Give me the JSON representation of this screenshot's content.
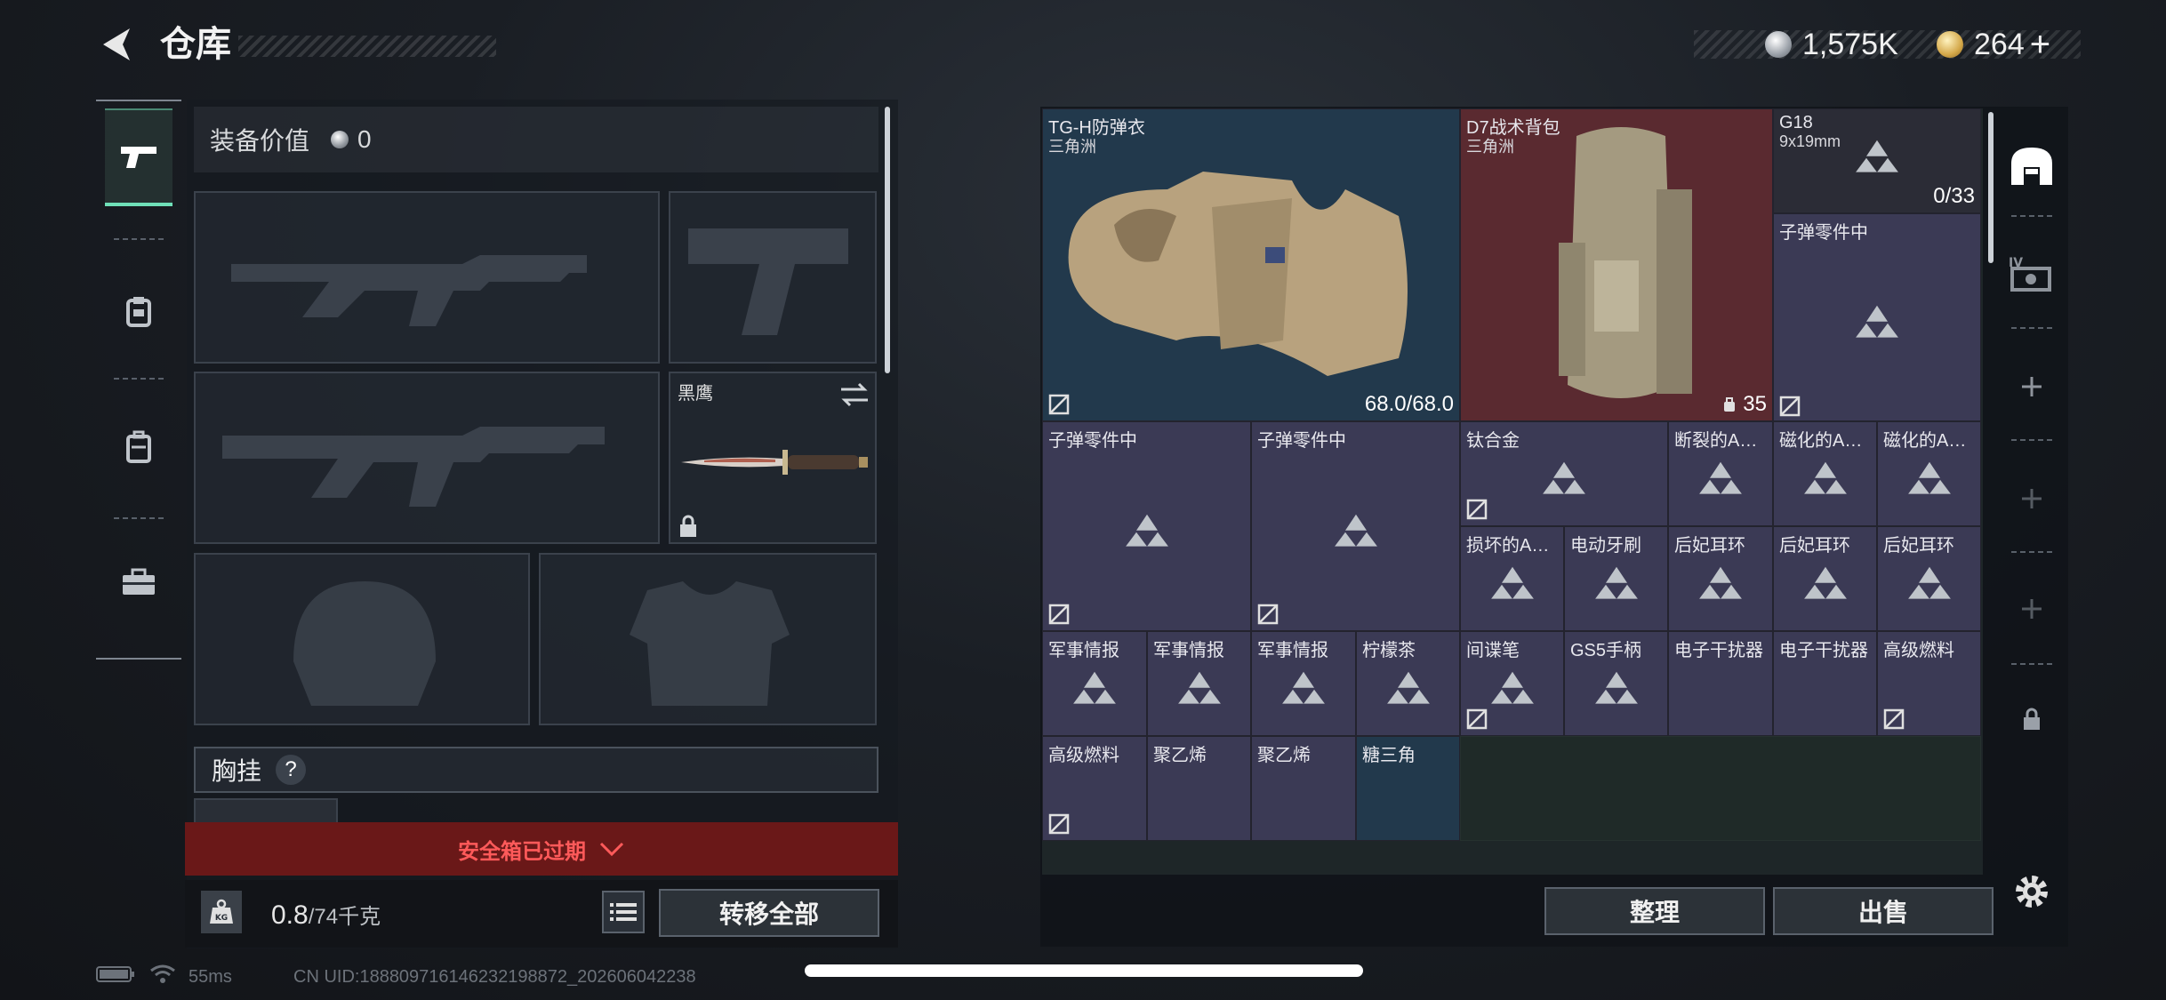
{
  "header": {
    "title": "仓库",
    "currency_silver": "1,575K",
    "currency_gold": "264",
    "gold_plus": "+"
  },
  "left_panel": {
    "equip_value_label": "装备价值",
    "equip_value": "0",
    "melee_name": "黑鹰",
    "chest_rig_label": "胸挂",
    "chest_rig_help": "?",
    "safe_box_status": "安全箱已过期",
    "weight_value": "0.8",
    "weight_unit": "/74千克",
    "transfer_all_label": "转移全部"
  },
  "stash": {
    "armor": {
      "name": "TG-H防弹衣",
      "origin": "三角洲",
      "durability": "68.0/68.0"
    },
    "backpack": {
      "name": "D7战术背包",
      "origin": "三角洲",
      "count": "35"
    },
    "pistol": {
      "name": "G18",
      "caliber": "9x19mm",
      "ammo": "0/33"
    },
    "items": [
      "子弹零件中",
      "子弹零件中",
      "子弹零件中",
      "钛合金",
      "断裂的A…",
      "磁化的A…",
      "磁化的A…",
      "损坏的A…",
      "电动牙刷",
      "后妃耳环",
      "后妃耳环",
      "后妃耳环",
      "军事情报",
      "军事情报",
      "军事情报",
      "柠檬茶",
      "间谍笔",
      "GS5手柄",
      "电子干扰器",
      "电子干扰器",
      "高级燃料",
      "高级燃料",
      "聚乙烯",
      "聚乙烯",
      "糖三角"
    ],
    "sort_label": "整理",
    "sell_label": "出售"
  },
  "status_bar": {
    "ping": "55ms",
    "uid": "CN UID:18880971614623219887​2_202606042238"
  }
}
